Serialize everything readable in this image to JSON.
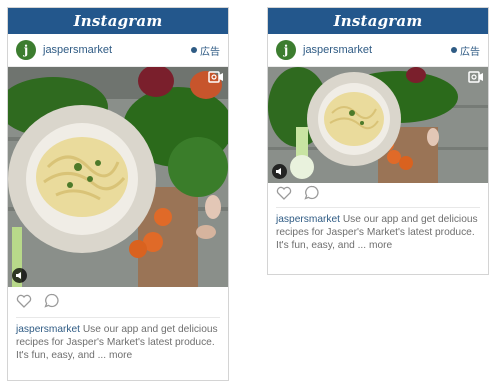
{
  "ads": [
    {
      "brand": "Instagram",
      "username": "jaspersmarket",
      "sponsored_label": "広告",
      "avatar_letter": "j",
      "caption_text": "Use our app and get delicious recipes for Jasper's Market's latest produce. It's fun, easy, and ...",
      "more_label": "more"
    },
    {
      "brand": "Instagram",
      "username": "jaspersmarket",
      "sponsored_label": "広告",
      "avatar_letter": "j",
      "caption_text": "Use our app and get delicious recipes for Jasper's Market's latest produce. It's fun, easy, and ...",
      "more_label": "more"
    }
  ],
  "colors": {
    "bar": "#23578c",
    "username": "#2f5b84",
    "caption": "#6f6f6f",
    "avatar": "#3c7d2f"
  },
  "icons": [
    "video-camera-icon",
    "sound-icon",
    "heart-icon",
    "comment-icon",
    "info-dot-icon"
  ]
}
